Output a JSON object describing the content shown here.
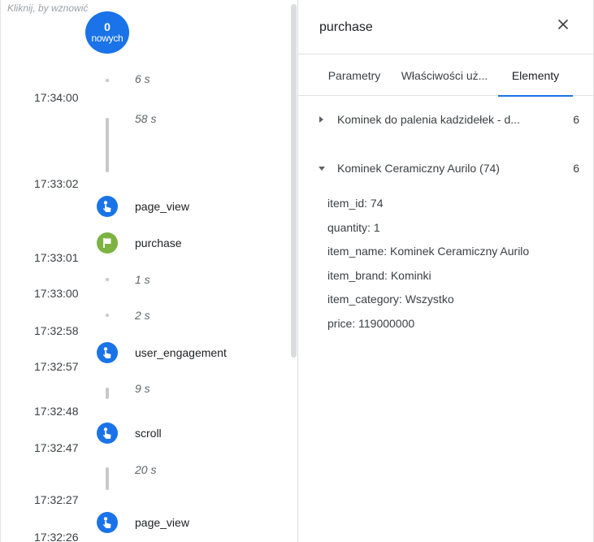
{
  "timeline": {
    "resume_text": "Kliknij, by wznowić",
    "new_count": "0",
    "new_label": "nowych",
    "times": [
      "17:34:00",
      "17:33:02",
      "17:33:01",
      "17:33:00",
      "17:32:58",
      "17:32:57",
      "17:32:48",
      "17:32:47",
      "17:32:27",
      "17:32:26"
    ],
    "gaps": [
      "6 s",
      "58 s",
      "1 s",
      "2 s",
      "9 s",
      "20 s"
    ],
    "events": [
      "page_view",
      "purchase",
      "user_engagement",
      "scroll",
      "page_view"
    ]
  },
  "panel": {
    "title": "purchase",
    "close_icon": "close-icon",
    "tabs": [
      "Parametry",
      "Właściwości uż...",
      "Elementy"
    ],
    "active_tab": "Elementy",
    "items": [
      {
        "title": "Kominek do palenia kadzidełek - d...",
        "count": "6",
        "expanded": false
      },
      {
        "title": "Kominek Ceramiczny Aurilo (74)",
        "count": "6",
        "expanded": true
      }
    ],
    "params": [
      "item_id: 74",
      "quantity: 1",
      "item_name: Kominek Ceramiczny Aurilo",
      "item_brand: Kominki",
      "item_category: Wszystko",
      "price: 119000000"
    ]
  },
  "colors": {
    "accent": "#1a73e8",
    "conversion": "#7cb342",
    "line": "#c8c8c8"
  }
}
